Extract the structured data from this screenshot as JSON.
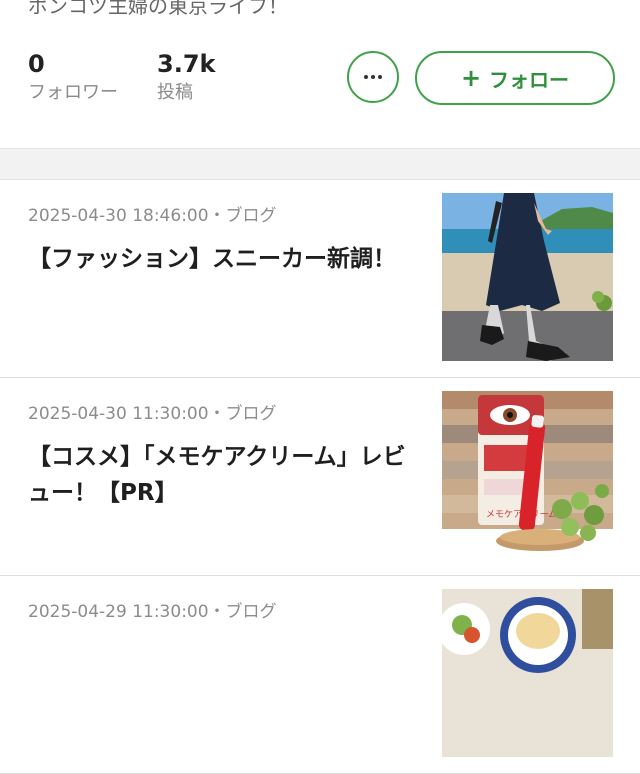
{
  "profile": {
    "bio": "ポンコツ主婦の東京ライフ！",
    "followers": {
      "value": "0",
      "label": "フォロワー"
    },
    "posts": {
      "value": "3.7k",
      "label": "投稿"
    },
    "follow_label": "フォロー",
    "accent_color": "#3fa14a"
  },
  "articles": [
    {
      "meta": "2025-04-30 18:46:00・ブログ",
      "title": "【ファッション】スニーカー新調！",
      "thumb_icon": "beach-walk-photo"
    },
    {
      "meta": "2025-04-30 11:30:00・ブログ",
      "title": "【コスメ】「メモケアクリーム」レビュー！【PR】",
      "thumb_icon": "eye-cream-product-photo",
      "product_text": "メモケアクリーム"
    },
    {
      "meta": "2025-04-29 11:30:00・ブログ",
      "title": "",
      "thumb_icon": "food-plates-photo"
    }
  ]
}
